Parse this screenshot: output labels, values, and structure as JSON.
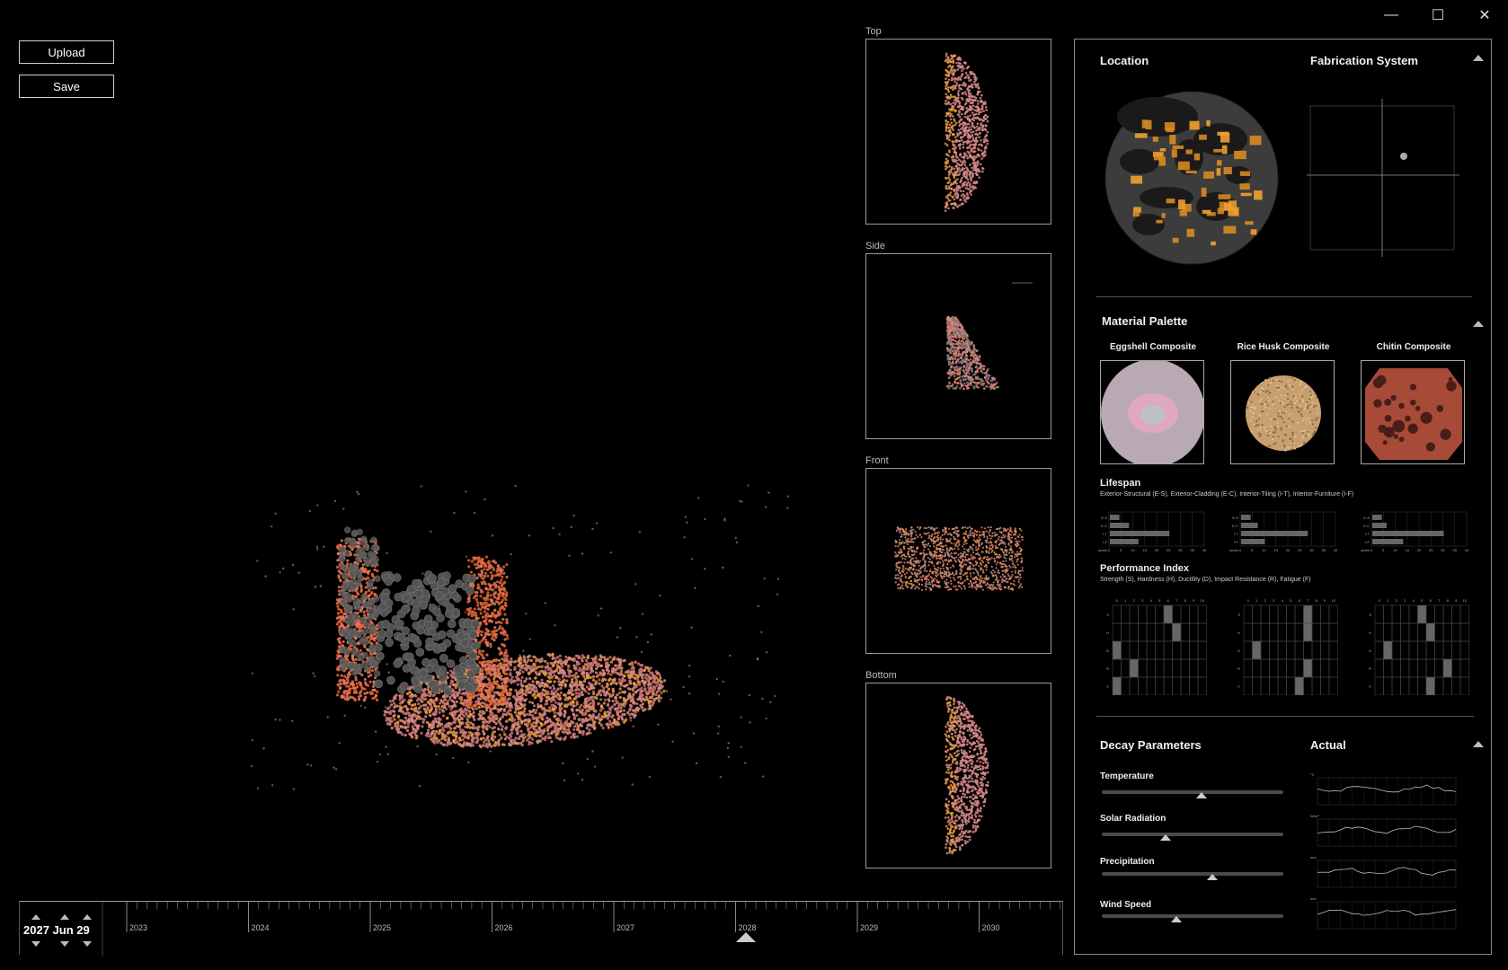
{
  "toolbar": {
    "upload_label": "Upload",
    "save_label": "Save"
  },
  "window_controls": {
    "minimize": "—",
    "maximize": "☐",
    "close": "✕"
  },
  "views": {
    "top": "Top",
    "side": "Side",
    "front": "Front",
    "bottom": "Bottom"
  },
  "location": {
    "title": "Location"
  },
  "fabrication": {
    "title": "Fabrication System",
    "marker": [
      0.65,
      0.35
    ]
  },
  "material": {
    "title": "Material Palette",
    "items": [
      {
        "label": "Eggshell Composite"
      },
      {
        "label": "Rice Husk Composite"
      },
      {
        "label": "Chitin Composite"
      }
    ]
  },
  "lifespan": {
    "title": "Lifespan",
    "subtitle": "Exterior-Structural (E-S), Exterior-Cladding (E-C), Interior-Tiling (I-T), Interior-Furniture (I-F)",
    "row_labels": [
      "E-S",
      "E-C",
      "I-T",
      "I-F"
    ],
    "axis_label": "years",
    "ticks": [
      "0",
      "5",
      "10",
      "15",
      "20",
      "25",
      "30",
      "35",
      "40"
    ],
    "charts": [
      {
        "values": [
          4,
          8,
          25,
          12
        ]
      },
      {
        "values": [
          4,
          7,
          28,
          10
        ]
      },
      {
        "values": [
          4,
          6,
          30,
          13
        ]
      }
    ]
  },
  "performance": {
    "title": "Performance Index",
    "subtitle": "Strength (S), Hardness (H), Ductility (D), Impact Resistance (R), Fatigue (F)",
    "row_labels": [
      "S",
      "H",
      "D",
      "R",
      "F"
    ],
    "ticks": [
      "0",
      "1",
      "2",
      "3",
      "4",
      "5",
      "6",
      "7",
      "8",
      "9",
      "10"
    ],
    "charts": [
      {
        "values": [
          6,
          7,
          0,
          2,
          0
        ]
      },
      {
        "values": [
          7,
          7,
          1,
          7,
          6
        ]
      },
      {
        "values": [
          5,
          6,
          1,
          8,
          6
        ]
      }
    ]
  },
  "decay": {
    "title": "Decay Parameters",
    "actual_title": "Actual",
    "params": [
      {
        "label": "Temperature",
        "value": 0.55
      },
      {
        "label": "Solar Radiation",
        "value": 0.35
      },
      {
        "label": "Precipitation",
        "value": 0.61
      },
      {
        "label": "Wind Speed",
        "value": 0.41
      }
    ],
    "units": [
      "°C",
      "W/m²",
      "mm",
      "m/s"
    ]
  },
  "timeline": {
    "years": [
      "2023",
      "2024",
      "2025",
      "2026",
      "2027",
      "2028",
      "2029",
      "2030"
    ],
    "date": "2027 Jun 29",
    "position": 0.6
  },
  "colors": {
    "accent": "#e07a5f",
    "orange": "#f0a030",
    "pink": "#d88a8a",
    "grey": "#666666"
  }
}
